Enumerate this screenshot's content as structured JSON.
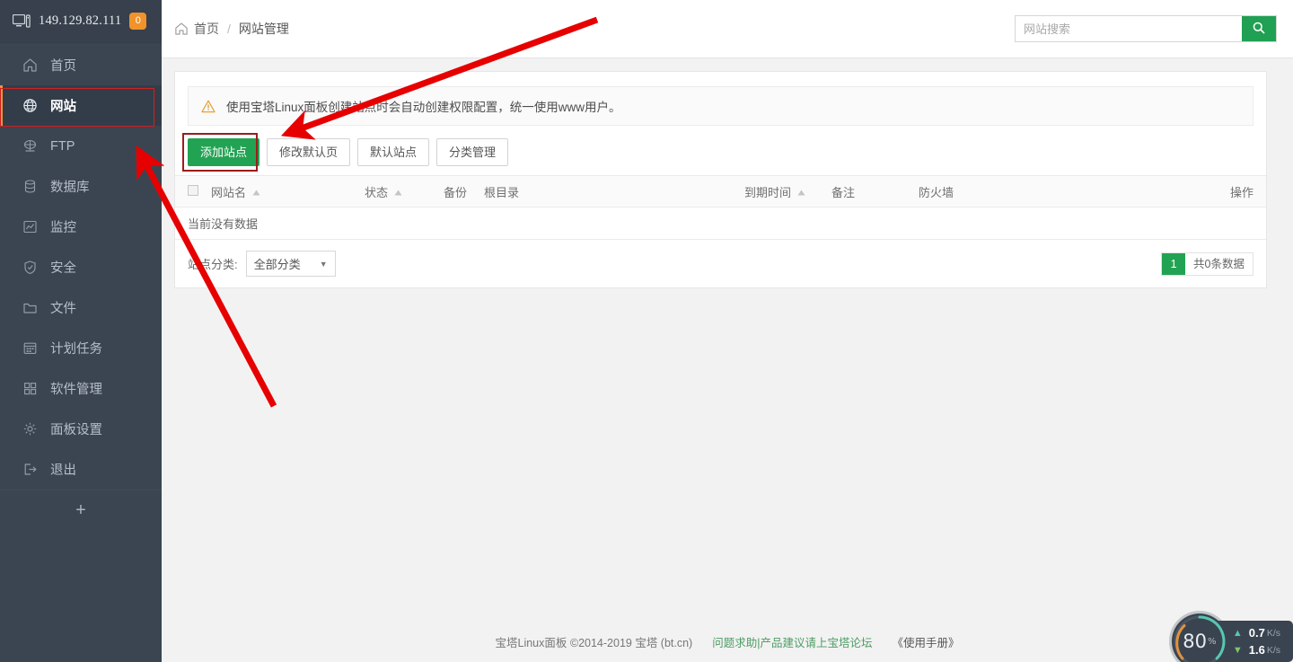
{
  "sidebar": {
    "header": {
      "icon": "monitor-icon",
      "ip": "149.129.82.111",
      "badge": "0"
    },
    "items": [
      {
        "icon": "home-icon",
        "label": "首页",
        "active": false
      },
      {
        "icon": "globe-icon",
        "label": "网站",
        "active": true
      },
      {
        "icon": "ftp-icon",
        "label": "FTP",
        "active": false
      },
      {
        "icon": "database-icon",
        "label": "数据库",
        "active": false
      },
      {
        "icon": "monitor-chart-icon",
        "label": "监控",
        "active": false
      },
      {
        "icon": "shield-icon",
        "label": "安全",
        "active": false
      },
      {
        "icon": "folder-icon",
        "label": "文件",
        "active": false
      },
      {
        "icon": "calendar-icon",
        "label": "计划任务",
        "active": false
      },
      {
        "icon": "grid-icon",
        "label": "软件管理",
        "active": false
      },
      {
        "icon": "gear-icon",
        "label": "面板设置",
        "active": false
      },
      {
        "icon": "logout-icon",
        "label": "退出",
        "active": false
      }
    ],
    "add_label": "+"
  },
  "topbar": {
    "breadcrumb": {
      "home": "首页",
      "separator": "/",
      "current": "网站管理"
    },
    "search": {
      "placeholder": "网站搜索",
      "value": "",
      "button_icon": "search-icon"
    }
  },
  "notice": {
    "icon": "warning-icon",
    "text": "使用宝塔Linux面板创建站点时会自动创建权限配置，统一使用www用户。"
  },
  "toolbar": {
    "add_site": "添加站点",
    "modify_default_page": "修改默认页",
    "default_site": "默认站点",
    "category_manage": "分类管理"
  },
  "table": {
    "columns": [
      {
        "label": "网站名",
        "sortable": true
      },
      {
        "label": "状态",
        "sortable": true
      },
      {
        "label": "备份",
        "sortable": false
      },
      {
        "label": "根目录",
        "sortable": false
      },
      {
        "label": "到期时间",
        "sortable": true
      },
      {
        "label": "备注",
        "sortable": false
      },
      {
        "label": "防火墙",
        "sortable": false
      },
      {
        "label": "操作",
        "sortable": false
      }
    ],
    "empty_text": "当前没有数据",
    "rows": []
  },
  "table_footer": {
    "category_label": "站点分类:",
    "category_value": "全部分类",
    "category_options": [
      "全部分类"
    ],
    "page_current": "1",
    "total_text": "共0条数据"
  },
  "footer": {
    "copyright": "宝塔Linux面板 ©2014-2019 宝塔 (bt.cn)",
    "forum_link": "问题求助|产品建议请上宝塔论坛",
    "manual_link": "《使用手册》"
  },
  "float_widget": {
    "percent": "80",
    "percent_unit": "%",
    "upload": {
      "value": "0.7",
      "unit": "K/s"
    },
    "download": {
      "value": "1.6",
      "unit": "K/s"
    }
  },
  "colors": {
    "sidebar_bg": "#3b4552",
    "accent_green": "#22a353",
    "accent_orange": "#f0932b",
    "annotation_red": "#e60000",
    "active_border": "#e8963a"
  }
}
